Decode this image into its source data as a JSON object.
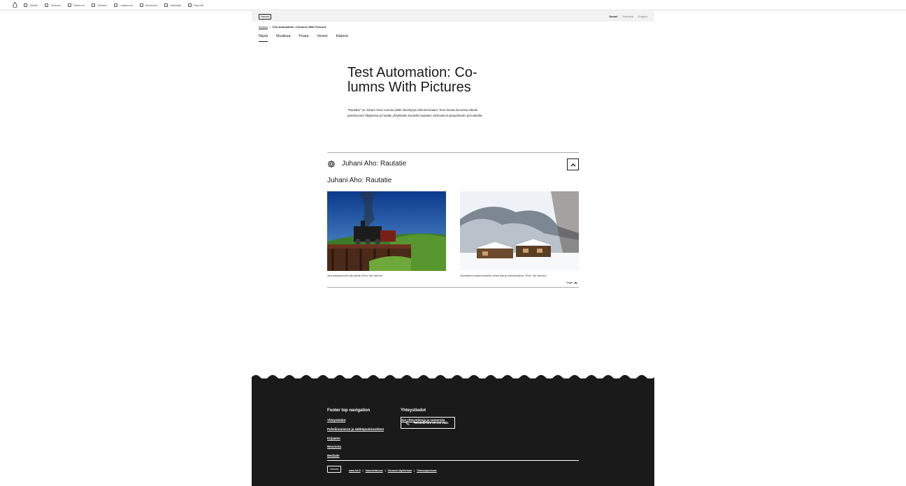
{
  "toolbar": {
    "items": [
      "Sisältö",
      "Työkalut",
      "Rakenne",
      "Ulkoasu",
      "Laajennus",
      "Asetukset",
      "Käyttäjät",
      "Raportit"
    ]
  },
  "header": {
    "logo": "Helsinki",
    "languages": [
      "Suomi",
      "Svenska",
      "English"
    ]
  },
  "breadcrumb": {
    "home": "Etusivu",
    "separator": ">",
    "current": "Test Automation: Columns With Pictures"
  },
  "tabs": [
    "Näytä",
    "Muokkaa",
    "Poista",
    "Versiot",
    "Käännä"
  ],
  "page": {
    "title": "Test Automation: Co-lumns With Pictures",
    "lead": "\"Rautatie\" on Juhani Ahon vuonna 1884 ilmestynyt esikoisromaani. Teos kuvaa korvessa elävän pariskunnan hiljaiseloa ja heidän yrityksiään kuvitella rautatien olemusta kuulopuheiden perusteella."
  },
  "accordion": {
    "heading": "Juhani Aho: Rautatie",
    "subheading": "Juhani Aho: Rautatie",
    "left_caption": "Juna puksuttaa kohti uutta päivää. Photo: Test Instructor.",
    "right_caption": "Suomalainen maaseutu talvella: lumiset talot ja vuoristomaisema. Photo: Test Instructor.",
    "close_label": "Sulje"
  },
  "footer": {
    "nav_title": "Footer top navigation",
    "nav_links": [
      "Yhteystiedot",
      "Puhelinnumerot ja sähköpostiosoitteet",
      "Kirjaamo",
      "Neuvonta",
      "Mediatie"
    ],
    "contact_title": "Yhteystiedot",
    "contact_link": "Hae yhteystietoja ja numeroita",
    "phone_label": "Helsinki-info 09 310 1691",
    "logo": "Helsinki",
    "bottom_links": [
      "www.hel.fi",
      "Saavutettavuus",
      "Sivuston käyttöehdot",
      "Tietosuojaseloste"
    ]
  },
  "colors": {
    "footer_bg": "#1a1a1a",
    "header_bg": "#f2f2f2",
    "text": "#1a1a1a"
  }
}
